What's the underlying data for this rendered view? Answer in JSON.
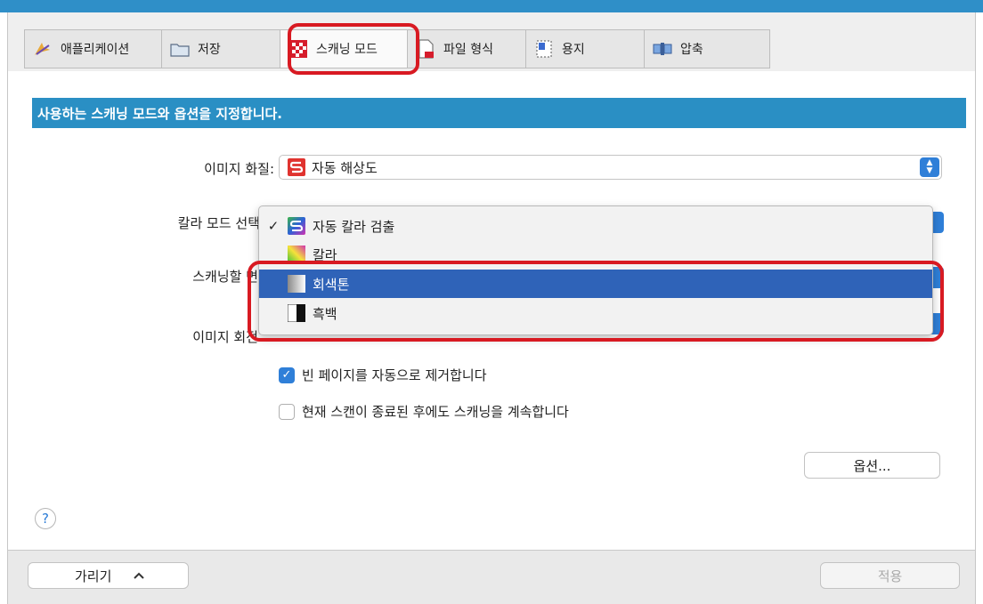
{
  "tabs": [
    {
      "label": "애플리케이션",
      "icon": "application-icon"
    },
    {
      "label": "저장",
      "icon": "folder-icon"
    },
    {
      "label": "스캐닝 모드",
      "icon": "scan-mode-icon",
      "active": true
    },
    {
      "label": "파일 형식",
      "icon": "file-format-icon"
    },
    {
      "label": "용지",
      "icon": "paper-icon"
    },
    {
      "label": "압축",
      "icon": "compression-icon"
    }
  ],
  "banner": "사용하는 스캐닝 모드와 옵션을 지정합니다.",
  "fields": {
    "image_quality_label": "이미지 화질:",
    "image_quality_value": "자동 해상도",
    "color_mode_label": "칼라 모드 선택",
    "scan_side_label": "스캐닝할 면",
    "rotation_label": "이미지 회전"
  },
  "color_mode_menu": [
    {
      "label": "자동 칼라 검출",
      "checked": true,
      "icon": "auto-color-icon"
    },
    {
      "label": "칼라",
      "checked": false,
      "icon": "color-icon"
    },
    {
      "label": "회색톤",
      "checked": false,
      "icon": "grayscale-icon",
      "highlighted": true
    },
    {
      "label": "흑백",
      "checked": false,
      "icon": "black-white-icon"
    }
  ],
  "checkboxes": [
    {
      "label": "빈 페이지를 자동으로 제거합니다",
      "checked": true
    },
    {
      "label": "현재 스캔이 종료된 후에도 스캐닝을 계속합니다",
      "checked": false
    }
  ],
  "buttons": {
    "options": "옵션...",
    "hide": "가리기",
    "apply": "적용",
    "help": "?"
  },
  "colors": {
    "accent": "#2f7fd8",
    "banner": "#2a8fc4",
    "highlight_ring": "#d81a22",
    "menu_selected": "#2f63b8"
  }
}
